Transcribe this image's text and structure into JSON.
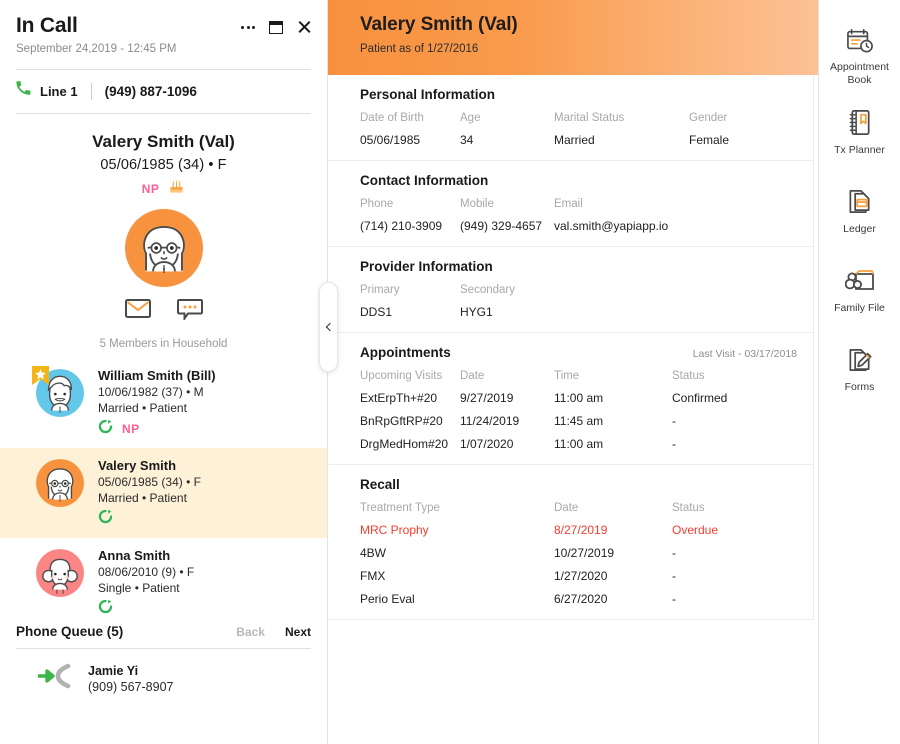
{
  "call_panel": {
    "title": "In Call",
    "datetime": "September 24,2019 - 12:45 PM",
    "more_label": "more-options",
    "line_label": "Line 1",
    "line_number": "(949) 887-1096",
    "hero": {
      "name": "Valery Smith (Val)",
      "dob_line": "05/06/1985  (34) • F",
      "np_badge": "NP",
      "birthday_icon": "birthday-cake-icon",
      "email_icon": "envelope-icon",
      "message_icon": "chat-bubble-icon",
      "household_count": "5 Members in Household"
    },
    "members": [
      {
        "name": "William Smith (Bill)",
        "dob": "10/06/1982 (37) • M",
        "relation": "Married • Patient",
        "avatar_color": "#62c7e8",
        "avatar_type": "male-adult",
        "star": true,
        "recall_icon": "recall-icon",
        "np_badge": "NP",
        "selected": false
      },
      {
        "name": "Valery Smith",
        "dob": "05/06/1985 (34) • F",
        "relation": "Married • Patient",
        "avatar_color": "#f7933f",
        "avatar_type": "female-adult",
        "star": false,
        "recall_icon": "recall-icon",
        "np_badge": "",
        "selected": true
      },
      {
        "name": "Anna Smith",
        "dob": "08/06/2010 (9) • F",
        "relation": "Single • Patient",
        "avatar_color": "#fb8484",
        "avatar_type": "female-child",
        "star": false,
        "recall_icon": "recall-icon",
        "np_badge": "",
        "selected": false
      }
    ],
    "queue": {
      "title": "Phone Queue (5)",
      "back_label": "Back",
      "next_label": "Next",
      "items": [
        {
          "name": "Jamie Yi",
          "phone": "(909) 567-8907",
          "icon": "incoming-call-icon"
        }
      ]
    }
  },
  "main": {
    "header": {
      "name": "Valery Smith (Val)",
      "subtitle": "Patient as of 1/27/2016"
    },
    "collapse_icon": "chevron-left-icon",
    "personal": {
      "title": "Personal Information",
      "labels": {
        "dob": "Date of Birth",
        "age": "Age",
        "marital": "Marital Status",
        "gender": "Gender"
      },
      "values": {
        "dob": "05/06/1985",
        "age": "34",
        "marital": "Married",
        "gender": "Female"
      }
    },
    "contact": {
      "title": "Contact Information",
      "labels": {
        "phone": "Phone",
        "mobile": "Mobile",
        "email": "Email"
      },
      "values": {
        "phone": "(714) 210-3909",
        "mobile": "(949) 329-4657",
        "email": "val.smith@yapiapp.io"
      }
    },
    "provider": {
      "title": "Provider Information",
      "labels": {
        "primary": "Primary",
        "secondary": "Secondary"
      },
      "values": {
        "primary": "DDS1",
        "secondary": "HYG1"
      }
    },
    "appointments": {
      "title": "Appointments",
      "last_visit": "Last Visit - 03/17/2018",
      "columns": {
        "visit": "Upcoming Visits",
        "date": "Date",
        "time": "Time",
        "status": "Status"
      },
      "rows": [
        {
          "visit": "ExtErpTh+#20",
          "date": "9/27/2019",
          "time": "11:00 am",
          "status": "Confirmed"
        },
        {
          "visit": "BnRpGftRP#20",
          "date": "11/24/2019",
          "time": "11:45 am",
          "status": "-"
        },
        {
          "visit": "DrgMedHom#20",
          "date": "1/07/2020",
          "time": "11:00 am",
          "status": "-"
        }
      ]
    },
    "recall": {
      "title": "Recall",
      "columns": {
        "type": "Treatment Type",
        "date": "Date",
        "status": "Status"
      },
      "rows": [
        {
          "type": "MRC Prophy",
          "date": "8/27/2019",
          "status": "Overdue",
          "overdue": true
        },
        {
          "type": "4BW",
          "date": "10/27/2019",
          "status": "-",
          "overdue": false
        },
        {
          "type": "FMX",
          "date": "1/27/2020",
          "status": "-",
          "overdue": false
        },
        {
          "type": "Perio Eval",
          "date": "6/27/2020",
          "status": "-",
          "overdue": false
        }
      ]
    }
  },
  "rail": {
    "items": [
      {
        "label": "Appointment Book",
        "icon": "calendar-clock-icon"
      },
      {
        "label": "Tx Planner",
        "icon": "notebook-icon"
      },
      {
        "label": "Ledger",
        "icon": "card-document-icon"
      },
      {
        "label": "Family File",
        "icon": "family-folder-icon"
      },
      {
        "label": "Forms",
        "icon": "document-pencil-icon"
      }
    ]
  },
  "colors": {
    "accent_orange": "#f7913f",
    "np_pink": "#ff5e92",
    "overdue_red": "#fb3b2e",
    "recall_green": "#2fb457",
    "selected_row": "#fdf1d8"
  }
}
